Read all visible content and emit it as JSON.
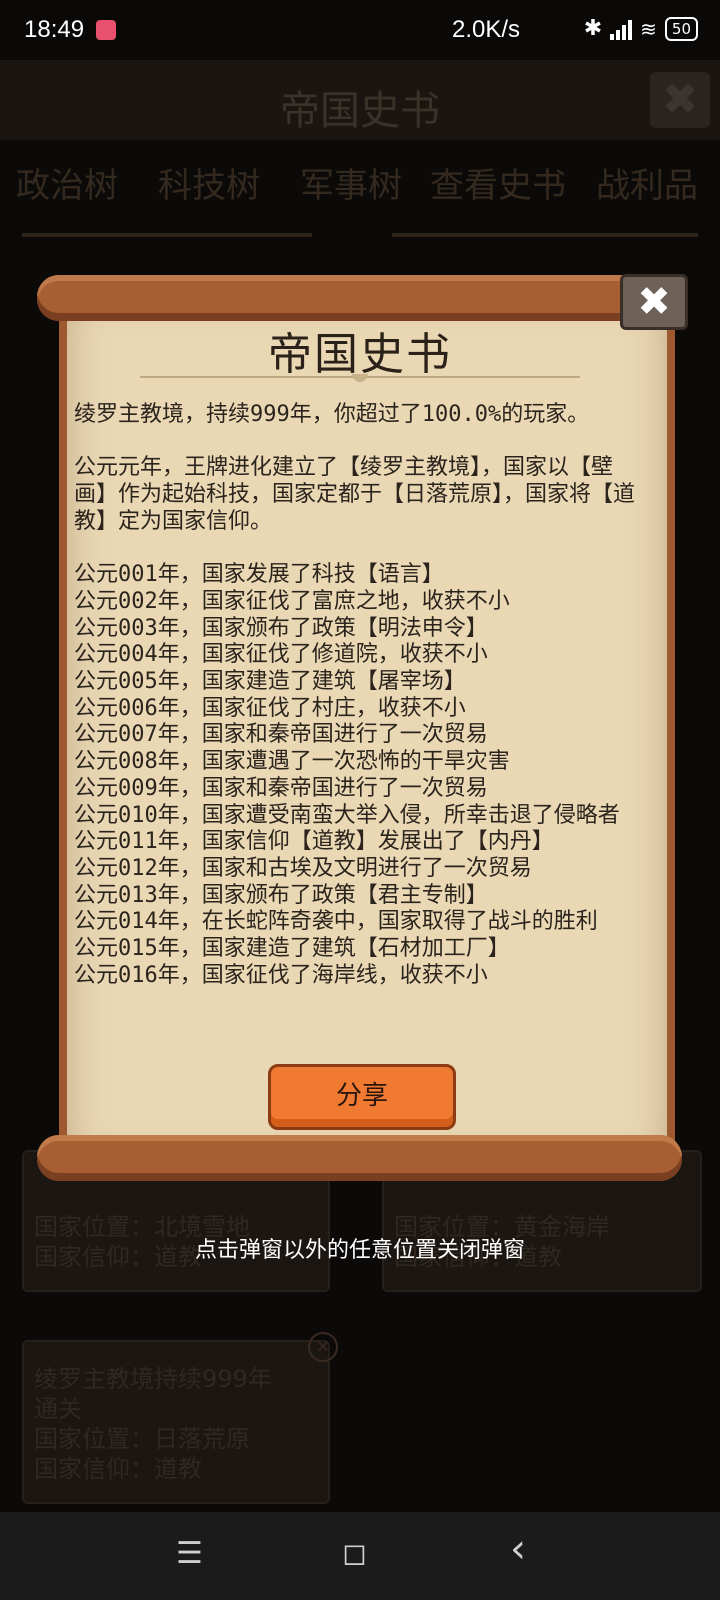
{
  "status_bar": {
    "time": "18:49",
    "net_speed": "2.0K/s",
    "battery": "50"
  },
  "background": {
    "title": "帝国史书",
    "tabs": [
      "政治树",
      "科技树",
      "军事树",
      "查看史书",
      "战利品"
    ],
    "cards": [
      {
        "line1": "国家位置：北境雪地",
        "line2": "国家信仰：道教"
      },
      {
        "line1": "国家位置：黄金海岸",
        "line2": "国家信仰：道教"
      },
      {
        "line1": "绫罗主教境持续999年",
        "line2": "通关",
        "line3": "国家位置：日落荒原",
        "line4": "国家信仰：道教"
      }
    ],
    "hint": "点击弹窗以外的任意位置关闭弹窗"
  },
  "popup": {
    "title": "帝国史书",
    "summary": "绫罗主教境，持续999年，你超过了100.0%的玩家。",
    "intro": "公元元年，王牌进化建立了【绫罗主教境】，国家以【壁画】作为起始科技，国家定都于【日落荒原】，国家将【道教】定为国家信仰。",
    "entries": [
      "公元001年，国家发展了科技【语言】",
      "公元002年，国家征伐了富庶之地，收获不小",
      "公元003年，国家颁布了政策【明法申令】",
      "公元004年，国家征伐了修道院，收获不小",
      "公元005年，国家建造了建筑【屠宰场】",
      "公元006年，国家征伐了村庄，收获不小",
      "公元007年，国家和秦帝国进行了一次贸易",
      "公元008年，国家遭遇了一次恐怖的干旱灾害",
      "公元009年，国家和秦帝国进行了一次贸易",
      "公元010年，国家遭受南蛮大举入侵，所幸击退了侵略者",
      "公元011年，国家信仰【道教】发展出了【内丹】",
      "公元012年，国家和古埃及文明进行了一次贸易",
      "公元013年，国家颁布了政策【君主专制】",
      "公元014年，在长蛇阵奇袭中，国家取得了战斗的胜利",
      "公元015年，国家建造了建筑【石材加工厂】",
      "公元016年，国家征伐了海岸线，收获不小"
    ],
    "share_label": "分享",
    "close_symbol": "✖"
  },
  "navbar": {
    "menu_symbol": "☰",
    "home_symbol": "◻",
    "back_symbol": "‹"
  }
}
